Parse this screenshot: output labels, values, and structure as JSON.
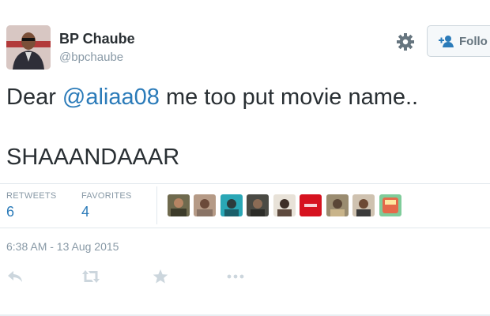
{
  "author": {
    "name": "BP Chaube",
    "handle": "@bpchaube"
  },
  "follow_button": {
    "label": "Follow",
    "visible_label": "Follo"
  },
  "tweet": {
    "text_prefix": "Dear ",
    "mention": "@aliaa08",
    "text_suffix": " me too put movie name..",
    "line2": "SHAAANDAAAR"
  },
  "stats": {
    "retweets_label": "RETWEETS",
    "retweets_count": "6",
    "favorites_label": "FAVORITES",
    "favorites_count": "4"
  },
  "timestamp": "6:38 AM - 13 Aug 2015",
  "actions": [
    "reply-icon",
    "retweet-icon",
    "favorite-icon",
    "more-icon"
  ],
  "colors": {
    "text": "#292f33",
    "link": "#2b7bb9",
    "muted": "#8899a6",
    "icon": "#ccd6dd",
    "divider": "#e1e8ed"
  }
}
